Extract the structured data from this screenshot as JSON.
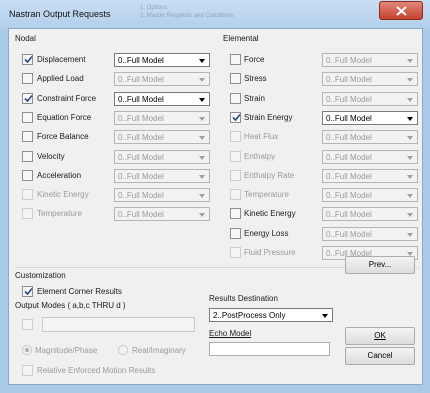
{
  "window": {
    "title": "Nastran Output Requests",
    "background_lines": [
      "1. Options",
      "2. Master Requests and Conditions"
    ]
  },
  "nodal": {
    "heading": "Nodal",
    "rows": [
      {
        "label": "Displacement",
        "checked": true,
        "enabled": true,
        "dropdown": "0..Full Model",
        "dropdown_enabled": true
      },
      {
        "label": "Applied Load",
        "checked": false,
        "enabled": true,
        "dropdown": "0..Full Model",
        "dropdown_enabled": false
      },
      {
        "label": "Constraint Force",
        "checked": true,
        "enabled": true,
        "dropdown": "0..Full Model",
        "dropdown_enabled": true
      },
      {
        "label": "Equation Force",
        "checked": false,
        "enabled": true,
        "dropdown": "0..Full Model",
        "dropdown_enabled": false
      },
      {
        "label": "Force Balance",
        "checked": false,
        "enabled": true,
        "dropdown": "0..Full Model",
        "dropdown_enabled": false
      },
      {
        "label": "Velocity",
        "checked": false,
        "enabled": true,
        "dropdown": "0..Full Model",
        "dropdown_enabled": false
      },
      {
        "label": "Acceleration",
        "checked": false,
        "enabled": true,
        "dropdown": "0..Full Model",
        "dropdown_enabled": false
      },
      {
        "label": "Kinetic Energy",
        "checked": false,
        "enabled": false,
        "dropdown": "0..Full Model",
        "dropdown_enabled": false
      },
      {
        "label": "Temperature",
        "checked": false,
        "enabled": false,
        "dropdown": "0..Full Model",
        "dropdown_enabled": false
      }
    ]
  },
  "elemental": {
    "heading": "Elemental",
    "rows": [
      {
        "label": "Force",
        "checked": false,
        "enabled": true,
        "dropdown": "0..Full Model",
        "dropdown_enabled": false
      },
      {
        "label": "Stress",
        "checked": false,
        "enabled": true,
        "dropdown": "0..Full Model",
        "dropdown_enabled": false
      },
      {
        "label": "Strain",
        "checked": false,
        "enabled": true,
        "dropdown": "0..Full Model",
        "dropdown_enabled": false
      },
      {
        "label": "Strain Energy",
        "checked": true,
        "enabled": true,
        "dropdown": "0..Full Model",
        "dropdown_enabled": true
      },
      {
        "label": "Heat Flux",
        "checked": false,
        "enabled": false,
        "dropdown": "0..Full Model",
        "dropdown_enabled": false
      },
      {
        "label": "Enthalpy",
        "checked": false,
        "enabled": false,
        "dropdown": "0..Full Model",
        "dropdown_enabled": false
      },
      {
        "label": "Enthalpy Rate",
        "checked": false,
        "enabled": false,
        "dropdown": "0..Full Model",
        "dropdown_enabled": false
      },
      {
        "label": "Temperature",
        "checked": false,
        "enabled": false,
        "dropdown": "0..Full Model",
        "dropdown_enabled": false
      },
      {
        "label": "Kinetic Energy",
        "checked": false,
        "enabled": true,
        "dropdown": "0..Full Model",
        "dropdown_enabled": false
      },
      {
        "label": "Energy Loss",
        "checked": false,
        "enabled": true,
        "dropdown": "0..Full Model",
        "dropdown_enabled": false
      },
      {
        "label": "Fluid Pressure",
        "checked": false,
        "enabled": false,
        "dropdown": "0..Full Model",
        "dropdown_enabled": false
      }
    ]
  },
  "customization": {
    "heading": "Customization",
    "element_corner_label": "Element Corner Results",
    "element_corner_checked": true,
    "output_modes_label": "Output Modes ( a,b,c THRU d )",
    "output_modes_value": "",
    "magnitude_phase_label": "Magnitude/Phase",
    "real_imaginary_label": "Real/Imaginary",
    "selected_radio": "Magnitude/Phase",
    "relative_label": "Relative Enforced Motion Results"
  },
  "results_destination": {
    "label": "Results Destination",
    "value": "2..PostProcess Only"
  },
  "echo_model": {
    "label": "Echo Model",
    "value": ""
  },
  "buttons": {
    "prev": "Prev...",
    "ok": "OK",
    "cancel": "Cancel"
  }
}
